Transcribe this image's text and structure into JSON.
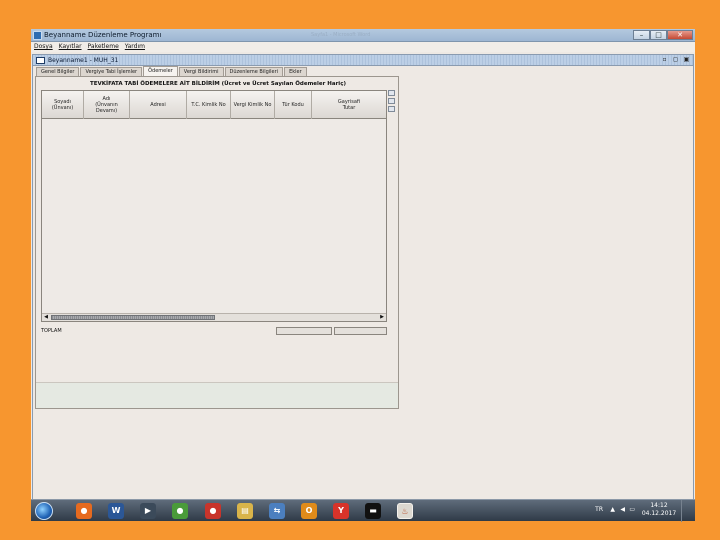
{
  "window": {
    "title": "Beyanname Düzenleme Programı",
    "faint_title": "Sayfa1 - Microsoft Word",
    "min_glyph": "–",
    "max_glyph": "□",
    "close_glyph": "✕"
  },
  "menu": [
    "Dosya",
    "Kayıtlar",
    "Paketleme",
    "Yardım"
  ],
  "inner_window": {
    "title": "Beyanname1 - MUH_31",
    "controls": [
      "▫",
      "◻",
      "▣"
    ]
  },
  "tabs": [
    {
      "label": "Genel Bilgiler",
      "active": false
    },
    {
      "label": "Vergiye Tabi İşlemler",
      "active": false
    },
    {
      "label": "Ödemeler",
      "active": true
    },
    {
      "label": "Vergi Bildirimi",
      "active": false
    },
    {
      "label": "Düzenleme Bilgileri",
      "active": false
    },
    {
      "label": "Ekler",
      "active": false
    }
  ],
  "section": {
    "title": "TEVKİFATA TABİ ÖDEMELERE AİT BİLDİRİM (Ücret ve Ücret Sayılan Ödemeler Hariç)"
  },
  "table": {
    "columns": [
      {
        "line1": "Soyadı",
        "line2": "(Ünvanı)"
      },
      {
        "line1": "Adı",
        "line2": "(Ünvanın Devamı)"
      },
      {
        "line1": "Adresi",
        "line2": ""
      },
      {
        "line1": "T.C. Kimlik No",
        "line2": ""
      },
      {
        "line1": "Vergi Kimlik No",
        "line2": ""
      },
      {
        "line1": "Tür Kodu",
        "line2": ""
      },
      {
        "line1": "Gayrisafi",
        "line2": "Tutar"
      }
    ],
    "rows": []
  },
  "scroll": {
    "left_arrow": "◀",
    "right_arrow": "▶"
  },
  "totals": {
    "label": "TOPLAM"
  },
  "taskbar": {
    "apps": [
      {
        "name": "firefox",
        "glyph": "●",
        "color": "#e66a1f"
      },
      {
        "name": "word",
        "glyph": "W",
        "color": "#2b5797"
      },
      {
        "name": "media",
        "glyph": "▶",
        "color": "#3b4a5a"
      },
      {
        "name": "chrome",
        "glyph": "●",
        "color": "#4a9b3a"
      },
      {
        "name": "chrome-alt",
        "glyph": "●",
        "color": "#c8342b"
      },
      {
        "name": "file-explorer",
        "glyph": "▤",
        "color": "#d9b44a"
      },
      {
        "name": "network",
        "glyph": "⇆",
        "color": "#4b7fbf"
      },
      {
        "name": "outlook",
        "glyph": "O",
        "color": "#e08b1a"
      },
      {
        "name": "yandex",
        "glyph": "Y",
        "color": "#d8332a"
      },
      {
        "name": "cmd",
        "glyph": "▬",
        "color": "#111111"
      },
      {
        "name": "java",
        "glyph": "♨",
        "color": "#c9c2b6"
      }
    ],
    "language": "TR",
    "tray_arrow": "▲",
    "volume_icon": "◀",
    "network_icon": "▭",
    "time": "14:12",
    "date": "04.12.2017"
  }
}
